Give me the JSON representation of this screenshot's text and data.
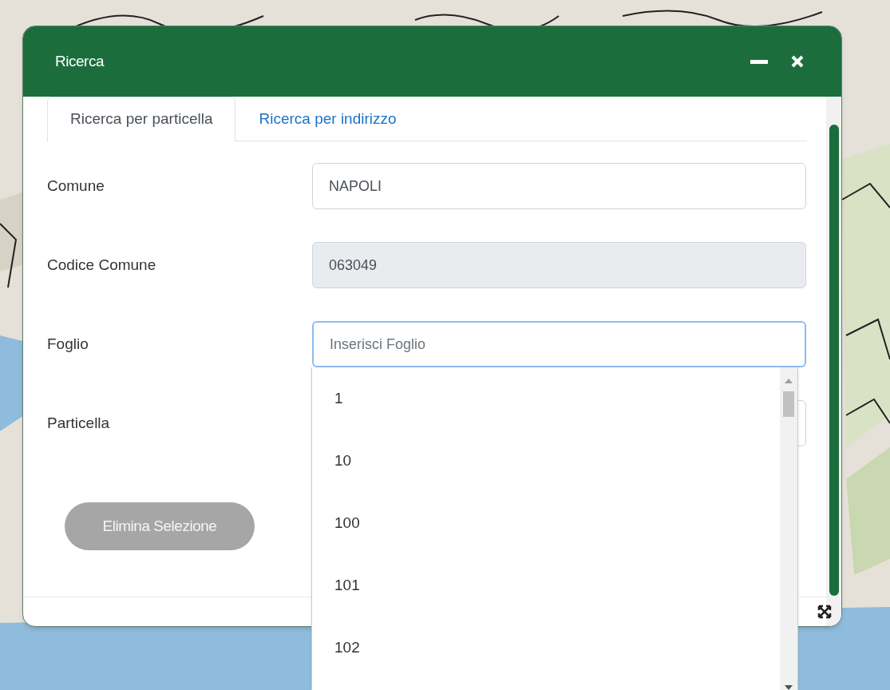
{
  "window": {
    "title": "Ricerca"
  },
  "tabs": [
    {
      "label": "Ricerca per particella",
      "selected": true
    },
    {
      "label": "Ricerca per indirizzo",
      "selected": false
    }
  ],
  "fields": [
    {
      "label": "Comune",
      "value": "NAPOLI",
      "disabled": false,
      "focused": false
    },
    {
      "label": "Codice Comune",
      "value": "063049",
      "disabled": true,
      "focused": false
    },
    {
      "label": "Foglio",
      "placeholder": "Inserisci Foglio",
      "disabled": false,
      "focused": true
    },
    {
      "label": "Particella",
      "disabled": false,
      "focused": false
    }
  ],
  "dropdown": {
    "options": [
      "1",
      "10",
      "100",
      "101",
      "102"
    ]
  },
  "button": {
    "label": "Elimina Selezione",
    "disabled": true
  }
}
